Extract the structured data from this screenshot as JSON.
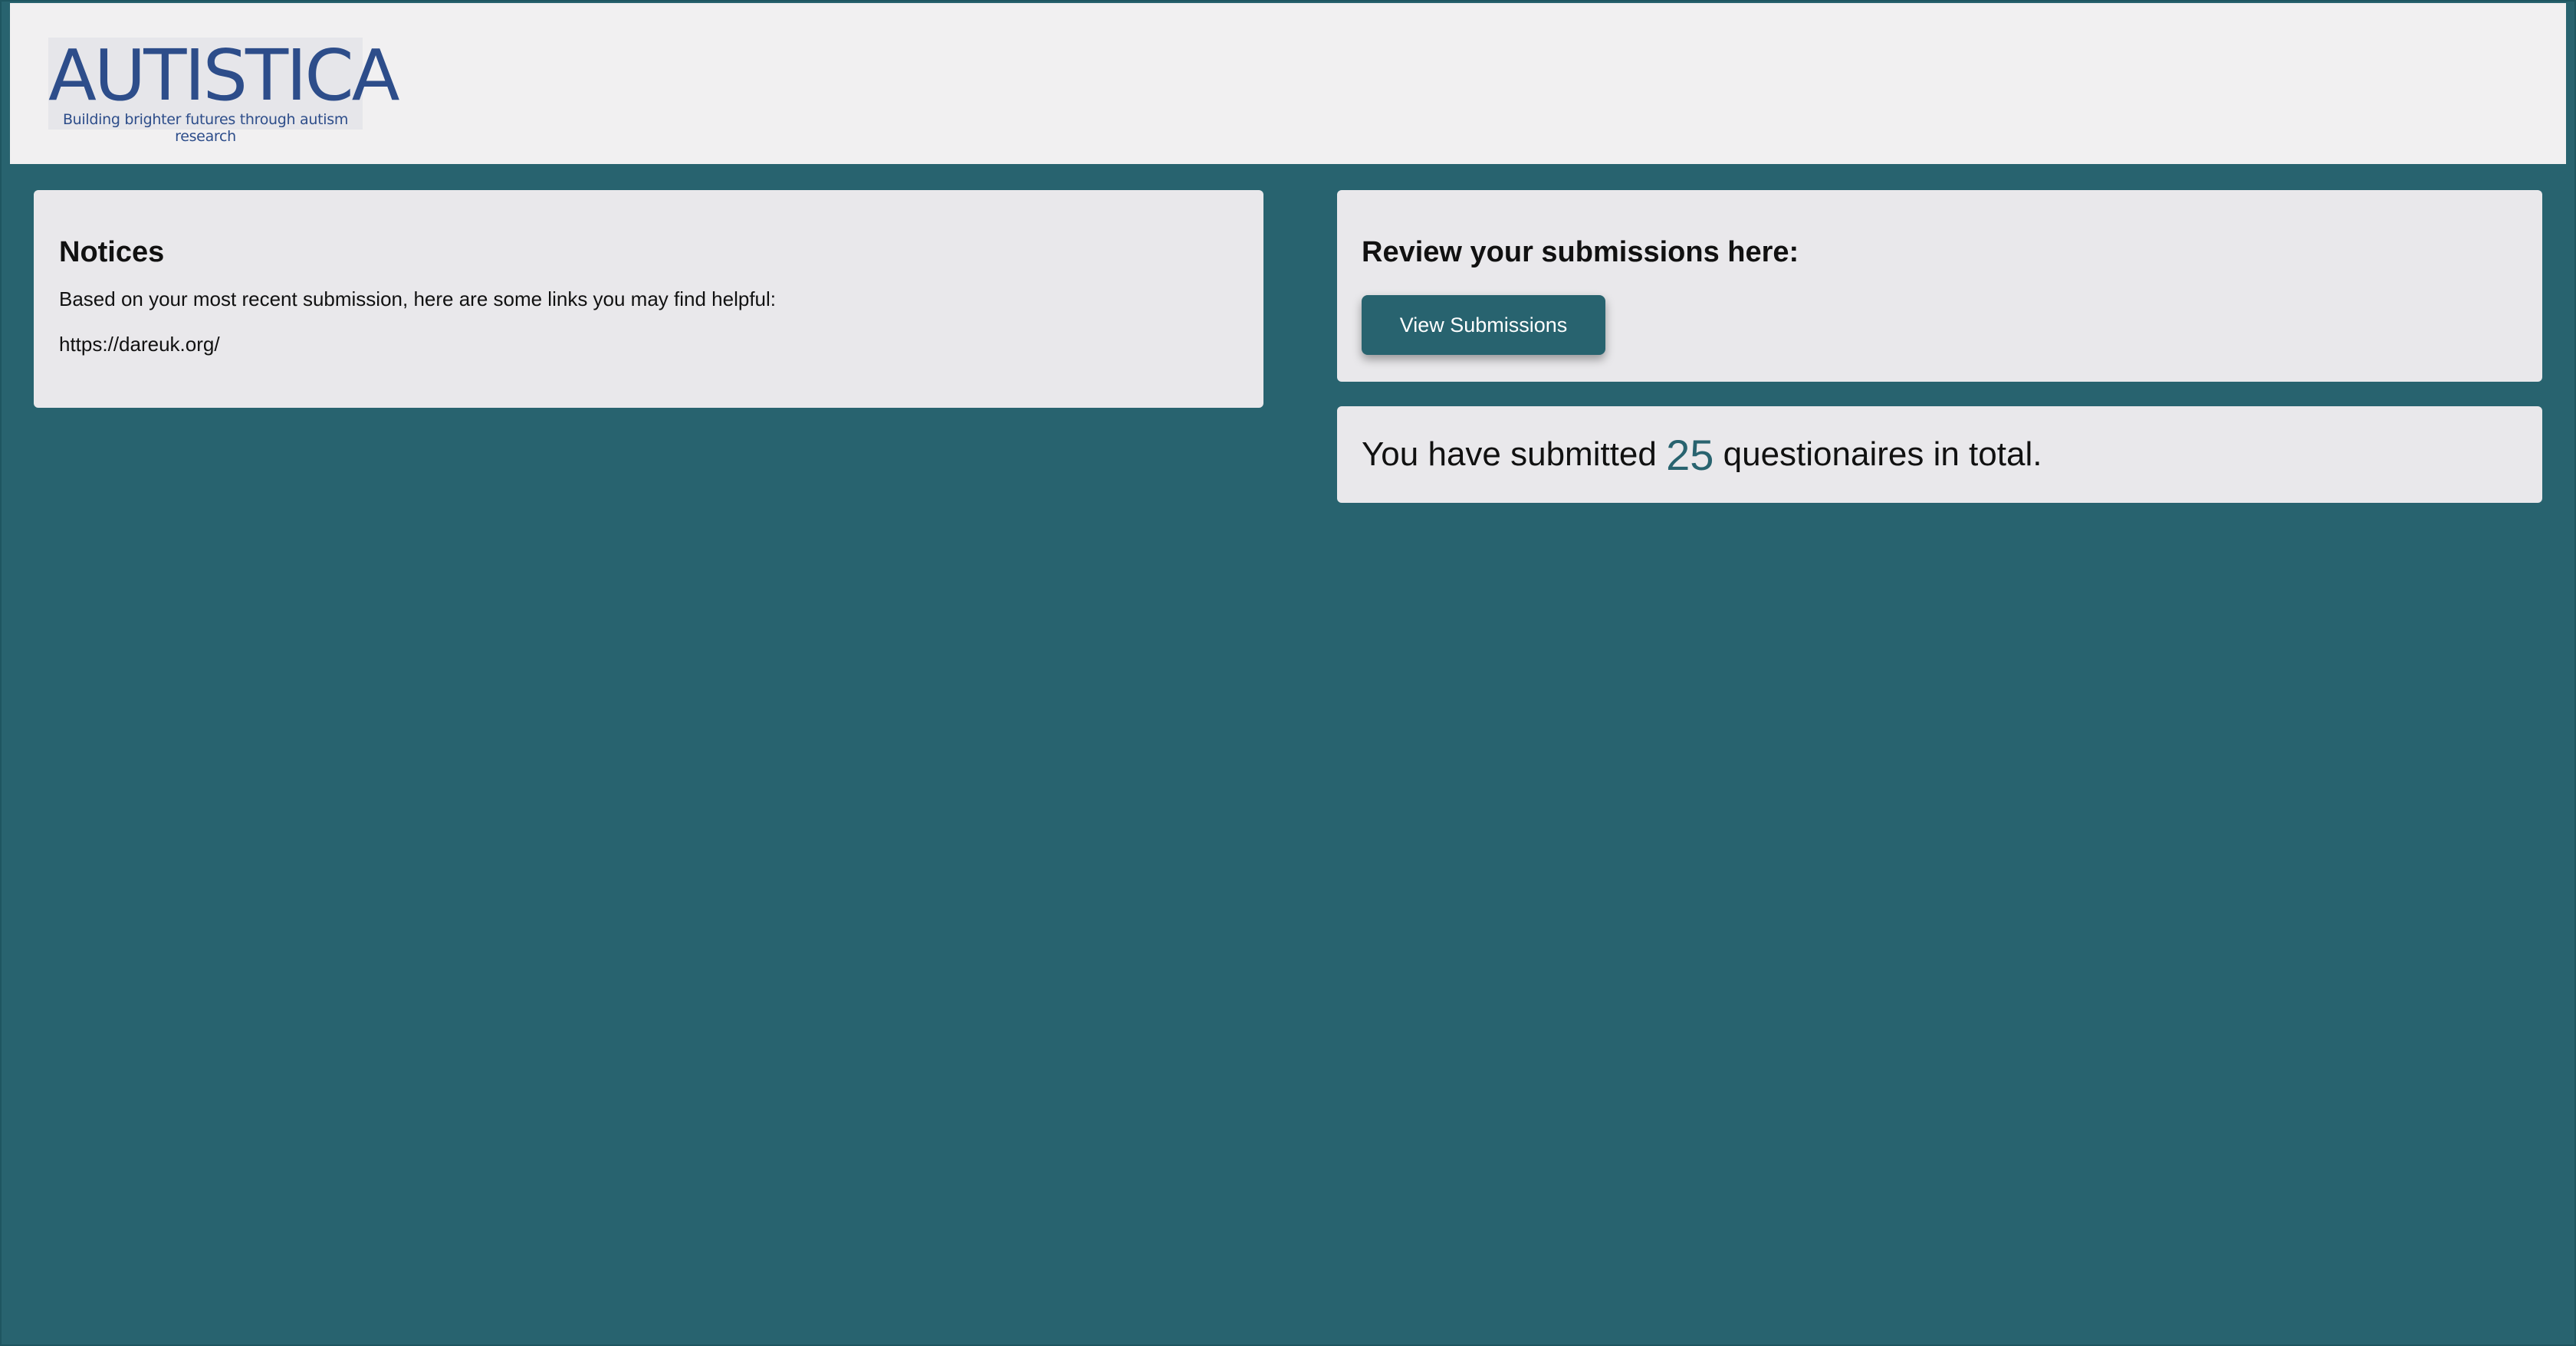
{
  "header": {
    "logo_text": "AUTISTICA",
    "logo_tagline": "Building brighter futures through autism research"
  },
  "notices": {
    "title": "Notices",
    "intro": "Based on your most recent submission, here are some links you may find helpful:",
    "link": "https://dareuk.org/"
  },
  "review": {
    "title": "Review your submissions here:",
    "button_label": "View Submissions"
  },
  "total": {
    "prefix": "You have submitted ",
    "count": "25",
    "suffix": " questionaires in total."
  },
  "colors": {
    "background": "#28636f",
    "card": "#e9e8eb",
    "header": "#f1f0f1",
    "brand": "#2d4d8a"
  }
}
